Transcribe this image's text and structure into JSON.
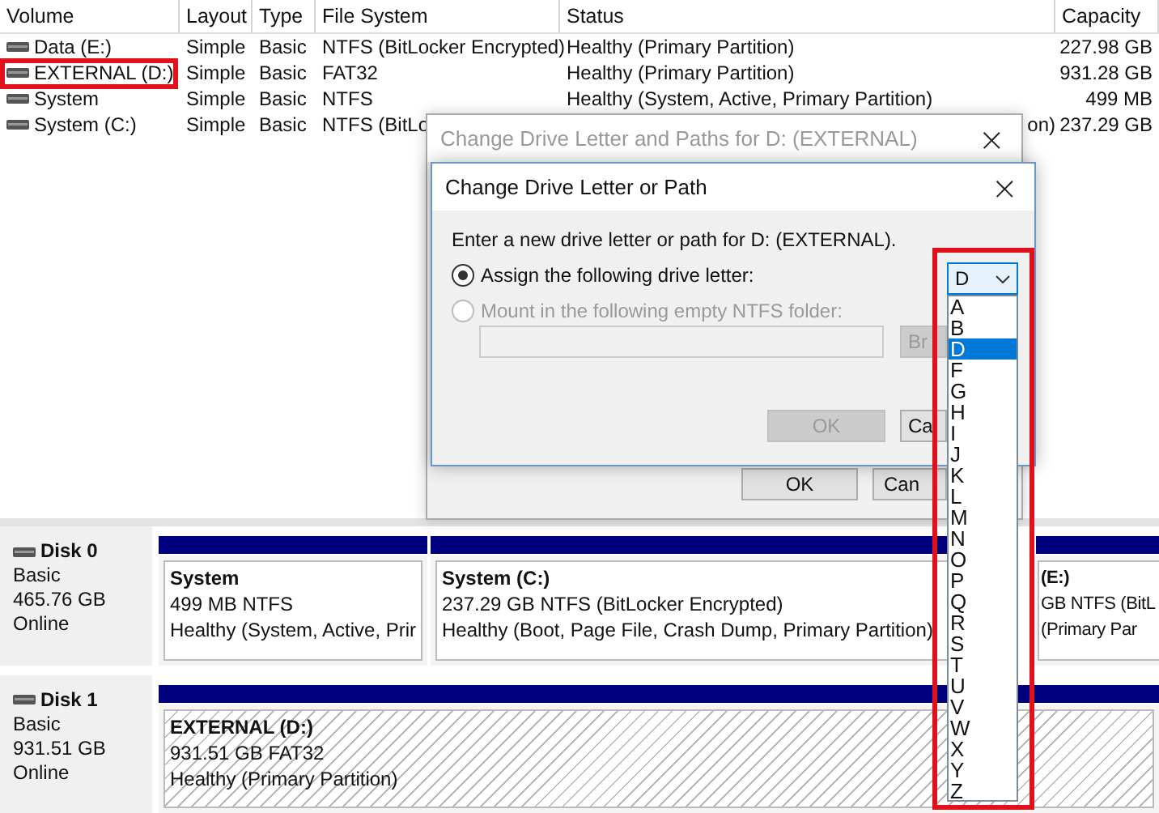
{
  "table": {
    "columns": [
      "Volume",
      "Layout",
      "Type",
      "File System",
      "Status",
      "Capacity"
    ],
    "rows": [
      {
        "volume": "Data (E:)",
        "layout": "Simple",
        "type": "Basic",
        "file_system": "NTFS (BitLocker Encrypted)",
        "status": "Healthy (Primary Partition)",
        "capacity": "227.98 GB",
        "annotated": false
      },
      {
        "volume": "EXTERNAL (D:)",
        "layout": "Simple",
        "type": "Basic",
        "file_system": "FAT32",
        "status": "Healthy (Primary Partition)",
        "capacity": "931.28 GB",
        "annotated": true
      },
      {
        "volume": "System",
        "layout": "Simple",
        "type": "Basic",
        "file_system": "NTFS",
        "status": "Healthy (System, Active, Primary Partition)",
        "capacity": "499 MB",
        "annotated": false
      },
      {
        "volume": "System (C:)",
        "layout": "Simple",
        "type": "Basic",
        "file_system": "NTFS (BitLo",
        "status": "on)",
        "capacity": "237.29 GB",
        "annotated": false
      }
    ]
  },
  "disks": [
    {
      "name": "Disk 0",
      "type": "Basic",
      "size": "465.76 GB",
      "state": "Online",
      "partitions": [
        {
          "title": "System",
          "detail": "499 MB NTFS",
          "status": "Healthy (System, Active, Prir",
          "selected": false
        },
        {
          "title": "System  (C:)",
          "detail": "237.29 GB NTFS (BitLocker Encrypted)",
          "status": "Healthy (Boot, Page File, Crash Dump, Primary Partition)",
          "selected": false
        },
        {
          "title": "(E:)",
          "detail": "GB NTFS (BitL",
          "status": "(Primary Par",
          "selected": false
        }
      ]
    },
    {
      "name": "Disk 1",
      "type": "Basic",
      "size": "931.51 GB",
      "state": "Online",
      "partitions": [
        {
          "title": "EXTERNAL  (D:)",
          "detail": "931.51 GB FAT32",
          "status": "Healthy (Primary Partition)",
          "selected": true
        }
      ]
    }
  ],
  "back_dialog": {
    "title": "Change Drive Letter and Paths for D: (EXTERNAL)",
    "close": "×",
    "buttons": [
      "OK",
      "Can"
    ]
  },
  "dialog": {
    "title": "Change Drive Letter or Path",
    "close": "×",
    "prompt": "Enter a new drive letter or path for D: (EXTERNAL).",
    "options": [
      {
        "label": "Assign the following drive letter:",
        "selected": true,
        "disabled": false
      },
      {
        "label": "Mount in the following empty NTFS folder:",
        "selected": false,
        "disabled": true
      }
    ],
    "browse_button": {
      "label": "Br",
      "disabled": true
    },
    "buttons": [
      {
        "label": "OK",
        "disabled": true
      },
      {
        "label": "Ca",
        "disabled": false
      }
    ]
  },
  "drive_letter": {
    "value": "D",
    "annotated": true,
    "items": [
      {
        "label": "A",
        "selected": false
      },
      {
        "label": "B",
        "selected": false
      },
      {
        "label": "D",
        "selected": true
      },
      {
        "label": "F",
        "selected": false
      },
      {
        "label": "G",
        "selected": false
      },
      {
        "label": "H",
        "selected": false
      },
      {
        "label": "I",
        "selected": false
      },
      {
        "label": "J",
        "selected": false
      },
      {
        "label": "K",
        "selected": false
      },
      {
        "label": "L",
        "selected": false
      },
      {
        "label": "M",
        "selected": false
      },
      {
        "label": "N",
        "selected": false
      },
      {
        "label": "O",
        "selected": false
      },
      {
        "label": "P",
        "selected": false
      },
      {
        "label": "Q",
        "selected": false
      },
      {
        "label": "R",
        "selected": false
      },
      {
        "label": "S",
        "selected": false
      },
      {
        "label": "T",
        "selected": false
      },
      {
        "label": "U",
        "selected": false
      },
      {
        "label": "V",
        "selected": false
      },
      {
        "label": "W",
        "selected": false
      },
      {
        "label": "X",
        "selected": false
      },
      {
        "label": "Y",
        "selected": false
      },
      {
        "label": "Z",
        "selected": false
      }
    ]
  }
}
